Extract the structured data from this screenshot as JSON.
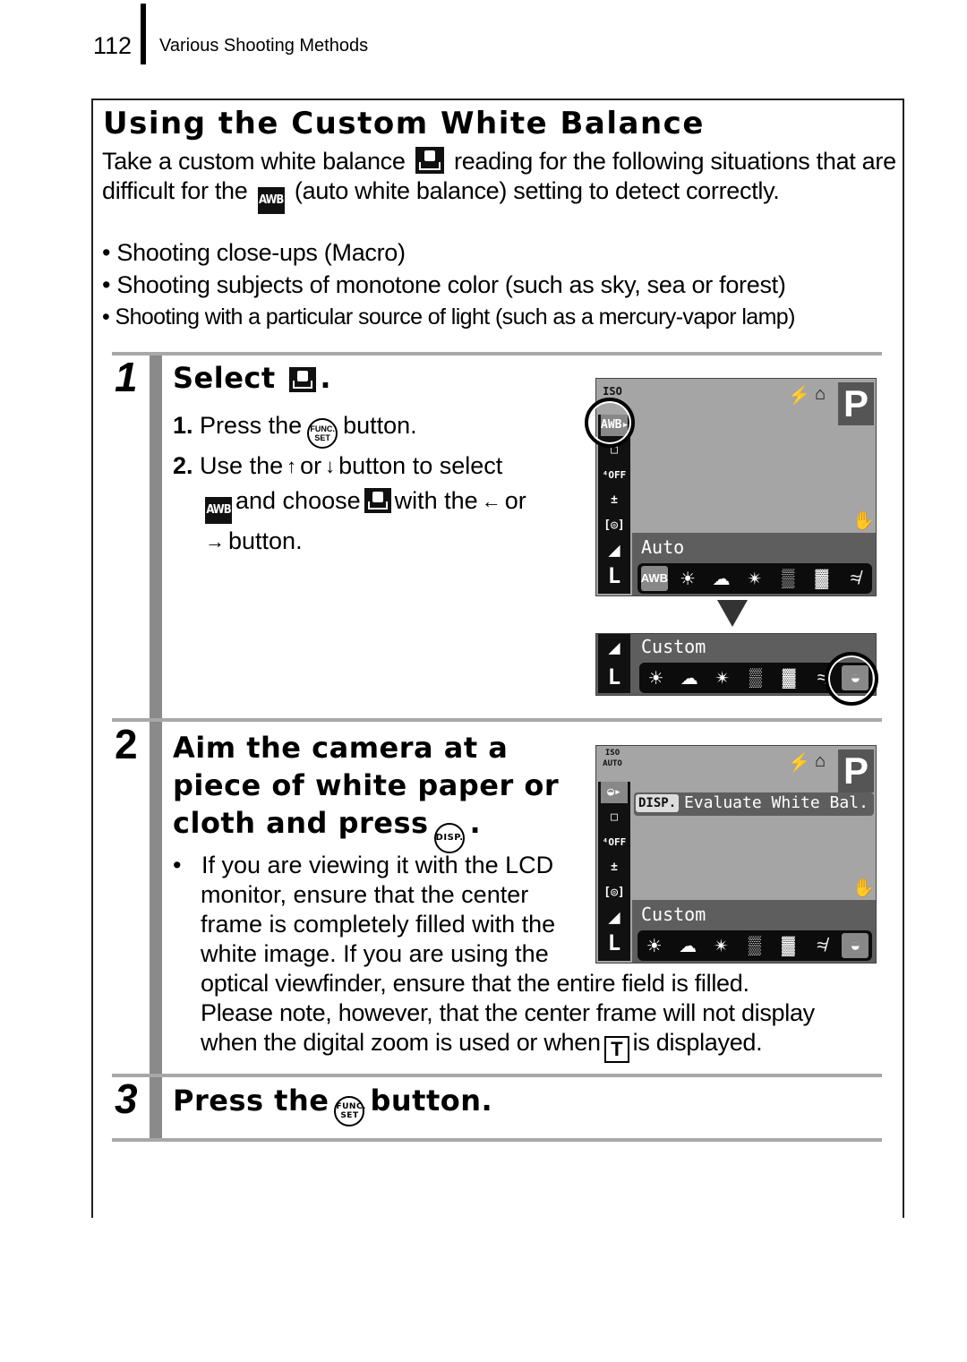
{
  "header": {
    "page_number": "112",
    "section": "Various Shooting Methods"
  },
  "title": "Using the Custom White Balance",
  "intro": {
    "part1": "Take a custom white balance",
    "part2": "reading for the following situations that are difficult for the",
    "part3": "(auto white balance) setting to detect correctly."
  },
  "bullets": [
    "Shooting close-ups (Macro)",
    "Shooting subjects of monotone color (such as sky, sea or forest)",
    "Shooting with a particular source of light (such as a mercury-vapor lamp)"
  ],
  "icons": {
    "awb": "AWB",
    "func_set_top": "FUNC.",
    "func_set_bottom": "SET",
    "disp": "DISP.",
    "t": "T",
    "up": "↑",
    "down": "↓",
    "left": "←",
    "right": "→"
  },
  "steps": [
    {
      "number": "1",
      "heading": "Select",
      "heading_suffix": ".",
      "substeps": [
        {
          "num": "1.",
          "a": "Press the",
          "b": "button."
        },
        {
          "num": "2.",
          "a": "Use the",
          "b": "or",
          "c": "button to select",
          "d": "and choose",
          "e": "with the",
          "f": "or",
          "g": "button."
        }
      ]
    },
    {
      "number": "2",
      "heading_lines": [
        "Aim the camera at a",
        "piece of white paper or",
        "cloth and press"
      ],
      "heading_suffix": ".",
      "note_lines": [
        "If you are viewing it with the LCD",
        "monitor, ensure that the center",
        "frame is completely filled with the",
        "white image. If you are using the",
        "optical viewfinder, ensure that the entire field is filled.",
        "Please note, however, that the center frame will not display",
        "when the digital zoom is used or when"
      ],
      "note_end": "is displayed."
    },
    {
      "number": "3",
      "heading_a": "Press the",
      "heading_b": "button."
    }
  ],
  "lcd1": {
    "iso": "ISO",
    "mode": "P",
    "side_items": [
      "AWB▸",
      "□",
      "⁴OFF",
      "±",
      "[◎]",
      "◢",
      "L"
    ],
    "label": "Auto",
    "wb_items": [
      "AWB",
      "☀",
      "☁",
      "✴",
      "▒",
      "▓",
      "≉"
    ]
  },
  "lcd2": {
    "label": "Custom",
    "wb_items": [
      "☀",
      "☁",
      "✴",
      "▒",
      "▓",
      "≉",
      "◒"
    ]
  },
  "lcd3": {
    "iso": "ISO AUTO",
    "mode": "P",
    "disp_label": "DISP.",
    "message": "Evaluate White Bal.",
    "label": "Custom",
    "side_items": [
      "◒▸",
      "□",
      "⁴OFF",
      "±",
      "[◎]",
      "◢",
      "L"
    ],
    "wb_items": [
      "☀",
      "☁",
      "✴",
      "▒",
      "▓",
      "≉",
      "◒"
    ]
  }
}
